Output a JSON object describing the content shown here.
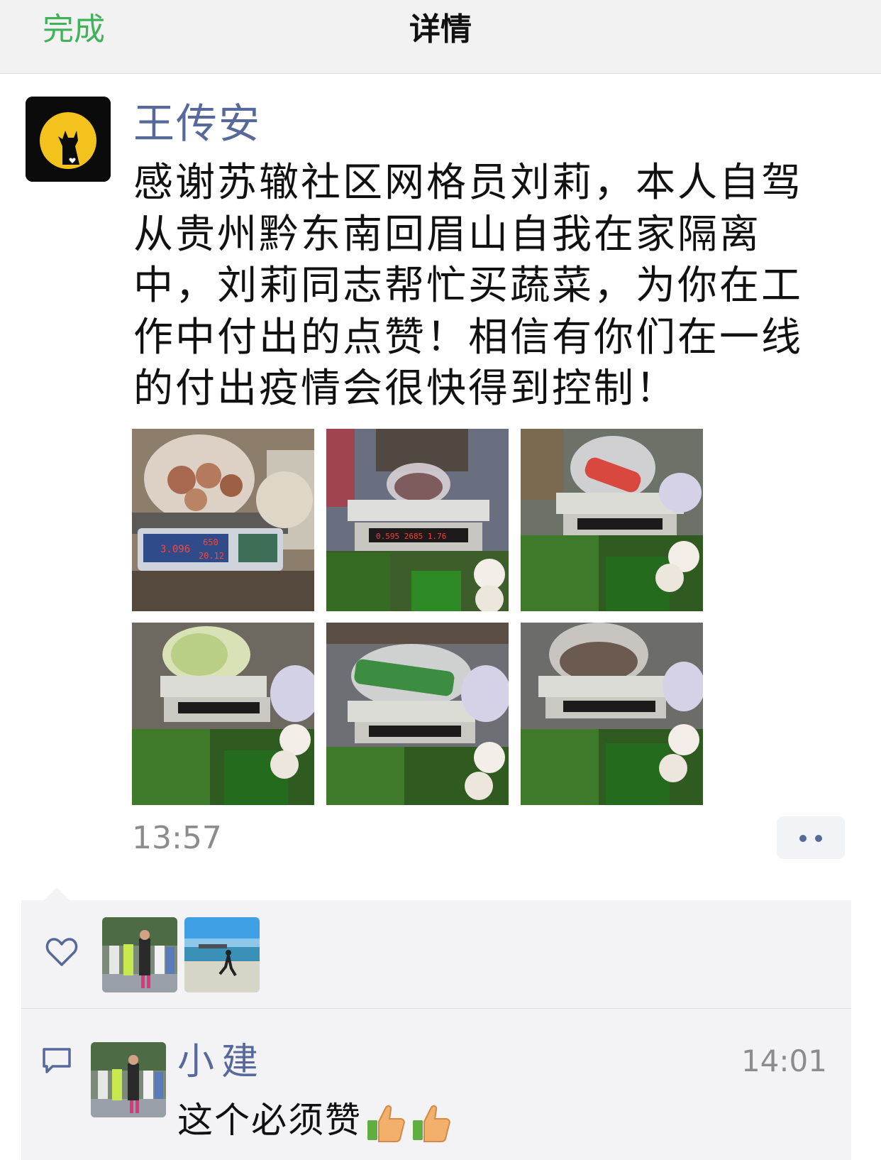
{
  "nav": {
    "done_label": "完成",
    "title": "详情"
  },
  "post": {
    "author": "王传安",
    "text": "感谢苏辙社区网格员刘莉，本人自驾从贵州黔东南回眉山自我在家隔离中，刘莉同志帮忙买蔬菜，为你在工作中付出的点赞！相信有你们在一线的付出疫情会很快得到控制！",
    "time": "13:57",
    "photos": [
      {
        "scale": "3.096 650 20.12"
      },
      {
        "scale": "2685"
      },
      {
        "scale": ""
      },
      {
        "scale": ""
      },
      {
        "scale": ""
      },
      {
        "scale": ""
      }
    ]
  },
  "likes": {
    "icon": "heart-outline-icon",
    "count": 2
  },
  "comments": [
    {
      "name": "小建",
      "time": "14:01",
      "text": "这个必须赞",
      "emoji": [
        "thumbs-up-icon",
        "thumbs-up-icon"
      ]
    }
  ],
  "colors": {
    "accent_green": "#3fb25a",
    "link_blue": "#56699a",
    "muted_gray": "#8c8c8c"
  }
}
